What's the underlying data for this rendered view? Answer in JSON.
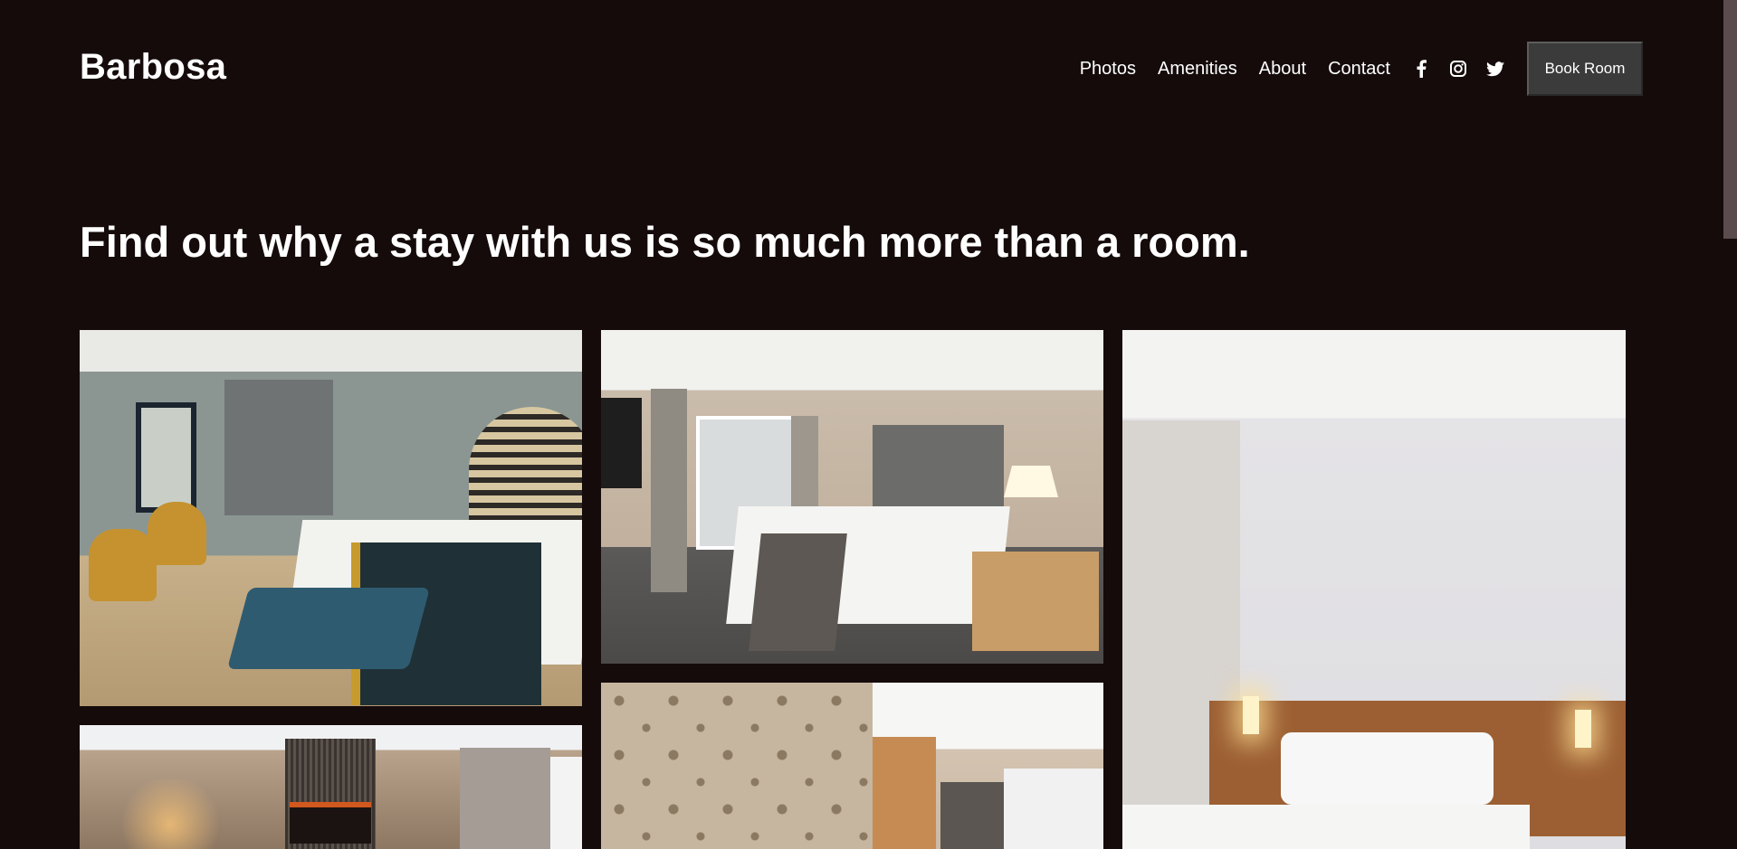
{
  "brand": {
    "name": "Barbosa"
  },
  "nav": {
    "links": [
      "Photos",
      "Amenities",
      "About",
      "Contact"
    ],
    "social": [
      "facebook-icon",
      "instagram-icon",
      "twitter-icon"
    ],
    "cta": "Book Room"
  },
  "hero": {
    "headline": "Find out why a stay with us is so much more than a room."
  },
  "gallery": {
    "photos": [
      {
        "subject": "blue-gray bedroom with mustard chairs and upholstered bench"
      },
      {
        "subject": "hotel room with gray headboard and bedside lamp"
      },
      {
        "subject": "white bedroom with wooden headboard and wall sconces"
      },
      {
        "subject": "bedroom with fireplace and curtains"
      },
      {
        "subject": "room with patterned wallpaper and window"
      }
    ]
  },
  "colors": {
    "background": "#150b0b",
    "text": "#ffffff",
    "button": "#3b3b3b",
    "scrollbar_thumb": "#5a4c4e"
  }
}
